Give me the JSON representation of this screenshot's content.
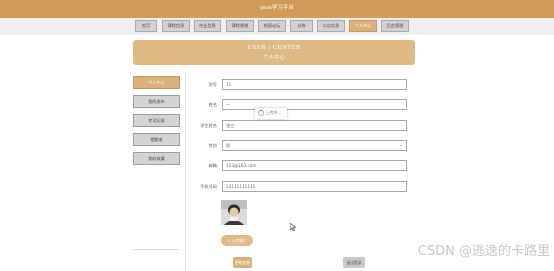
{
  "header": {
    "title": "java学习平台"
  },
  "nav": {
    "items": [
      {
        "label": "首页"
      },
      {
        "label": "课程信息"
      },
      {
        "label": "作业信息"
      },
      {
        "label": "课程视频"
      },
      {
        "label": "校园论坛"
      },
      {
        "label": "试卷"
      },
      {
        "label": "公告信息"
      },
      {
        "label": "个人中心"
      },
      {
        "label": "后台管理"
      }
    ],
    "active_index": 7
  },
  "banner": {
    "en": "USER / CENTER",
    "cn": "个人中心"
  },
  "sidebar": {
    "items": [
      {
        "label": "个人中心"
      },
      {
        "label": "我的发布"
      },
      {
        "label": "考试记录"
      },
      {
        "label": "错题本"
      },
      {
        "label": "我的收藏"
      }
    ]
  },
  "form": {
    "student_no": {
      "label": "学号",
      "value": "11"
    },
    "name": {
      "label": "姓名",
      "value": "一"
    },
    "student_id_card": {
      "label": "学生姓名",
      "value": "张三"
    },
    "gender": {
      "label": "性别",
      "value": "男"
    },
    "email": {
      "label": "邮箱",
      "value": "123@163.com"
    },
    "phone": {
      "label": "手机号码",
      "value": "13111111111"
    }
  },
  "loading_text": "上传中...",
  "buttons": {
    "upload": "上传图片",
    "save": "更新信息",
    "logout": "退出登录"
  },
  "watermark": "CSDN @逃逸的卡路里",
  "colors": {
    "accent": "#d09a58",
    "active_tab": "#dab17c"
  }
}
